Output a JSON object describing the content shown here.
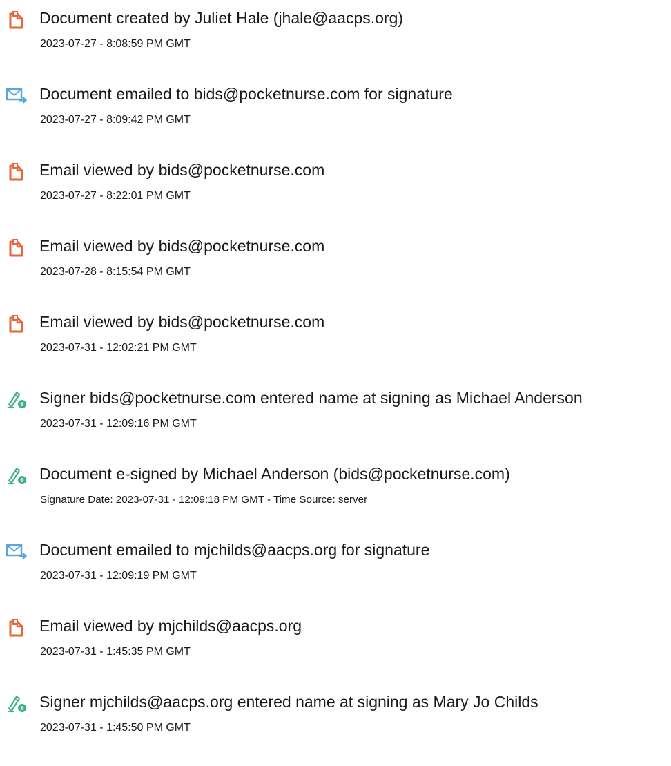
{
  "events": [
    {
      "icon": "document-icon",
      "title": "Document created by Juliet Hale (jhale@aacps.org)",
      "time": "2023-07-27 - 8:08:59 PM GMT"
    },
    {
      "icon": "email-sent-icon",
      "title": "Document emailed to bids@pocketnurse.com for signature",
      "time": "2023-07-27 - 8:09:42 PM GMT"
    },
    {
      "icon": "document-icon",
      "title": "Email viewed by bids@pocketnurse.com",
      "time": "2023-07-27 - 8:22:01 PM GMT"
    },
    {
      "icon": "document-icon",
      "title": "Email viewed by bids@pocketnurse.com",
      "time": "2023-07-28 - 8:15:54 PM GMT"
    },
    {
      "icon": "document-icon",
      "title": "Email viewed by bids@pocketnurse.com",
      "time": "2023-07-31 - 12:02:21 PM GMT"
    },
    {
      "icon": "esign-icon",
      "title": "Signer bids@pocketnurse.com entered name at signing as Michael Anderson",
      "time": "2023-07-31 - 12:09:16 PM GMT"
    },
    {
      "icon": "esign-icon",
      "title": "Document e-signed by Michael Anderson (bids@pocketnurse.com)",
      "time": "Signature Date: 2023-07-31 - 12:09:18 PM GMT - Time Source: server"
    },
    {
      "icon": "email-sent-icon",
      "title": "Document emailed to mjchilds@aacps.org for signature",
      "time": "2023-07-31 - 12:09:19 PM GMT"
    },
    {
      "icon": "document-icon",
      "title": "Email viewed by mjchilds@aacps.org",
      "time": "2023-07-31 - 1:45:35 PM GMT"
    },
    {
      "icon": "esign-icon",
      "title": "Signer mjchilds@aacps.org entered name at signing as Mary Jo Childs",
      "time": "2023-07-31 - 1:45:50 PM GMT"
    }
  ],
  "colors": {
    "document_icon": "#e8643a",
    "email_icon": "#5aa8d8",
    "esign_icon": "#3fae8f",
    "text": "#1a1a1a"
  }
}
